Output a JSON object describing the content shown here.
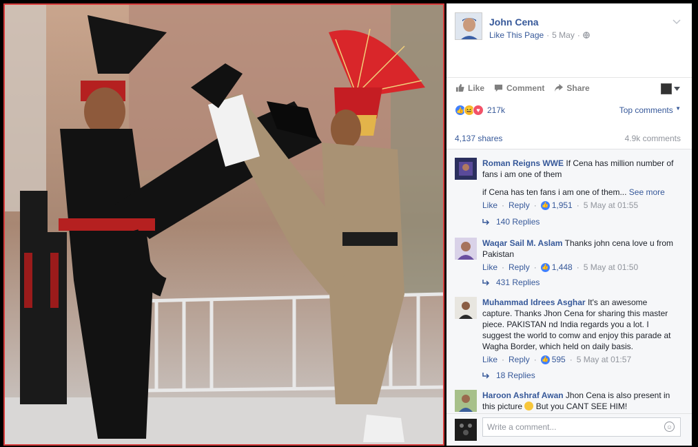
{
  "post": {
    "page_name": "John Cena",
    "like_page": "Like This Page",
    "date": "5 May",
    "separator": "·"
  },
  "actions": {
    "like": "Like",
    "comment": "Comment",
    "share": "Share"
  },
  "reactions": {
    "count": "217k",
    "top_comments": "Top comments"
  },
  "stats": {
    "shares": "4,137 shares",
    "comments": "4.9k comments"
  },
  "comments": [
    {
      "name": "Roman Reigns WWE",
      "text": "If Cena has million number of fans i am one of them",
      "text2": "if Cena has ten fans i am one of them...",
      "see_more": "See more",
      "like": "Like",
      "reply": "Reply",
      "likes": "1,951",
      "time": "5 May at 01:55",
      "replies": "140 Replies"
    },
    {
      "name": "Waqar Sail M. Aslam",
      "text": "Thanks john cena love u from Pakistan",
      "like": "Like",
      "reply": "Reply",
      "likes": "1,448",
      "time": "5 May at 01:50",
      "replies": "431 Replies"
    },
    {
      "name": "Muhammad Idrees Asghar",
      "text": "It's an awesome capture. Thanks Jhon Cena for sharing this master piece. PAKISTAN nd India regards you a lot. I suggest the world to comw and enjoy this parade at Wagha Border, which held on daily basis.",
      "like": "Like",
      "reply": "Reply",
      "likes": "595",
      "time": "5 May at 01:57",
      "replies": "18 Replies"
    },
    {
      "name": "Haroon Ashraf Awan",
      "text": "Jhon Cena is also present in this picture",
      "text2": "But you CANT SEE HIM!"
    }
  ],
  "write": {
    "placeholder": "Write a comment..."
  },
  "colors": {
    "link": "#365899",
    "muted": "#90949c",
    "frame": "#d83a3a",
    "like_blue": "#4080ff"
  }
}
